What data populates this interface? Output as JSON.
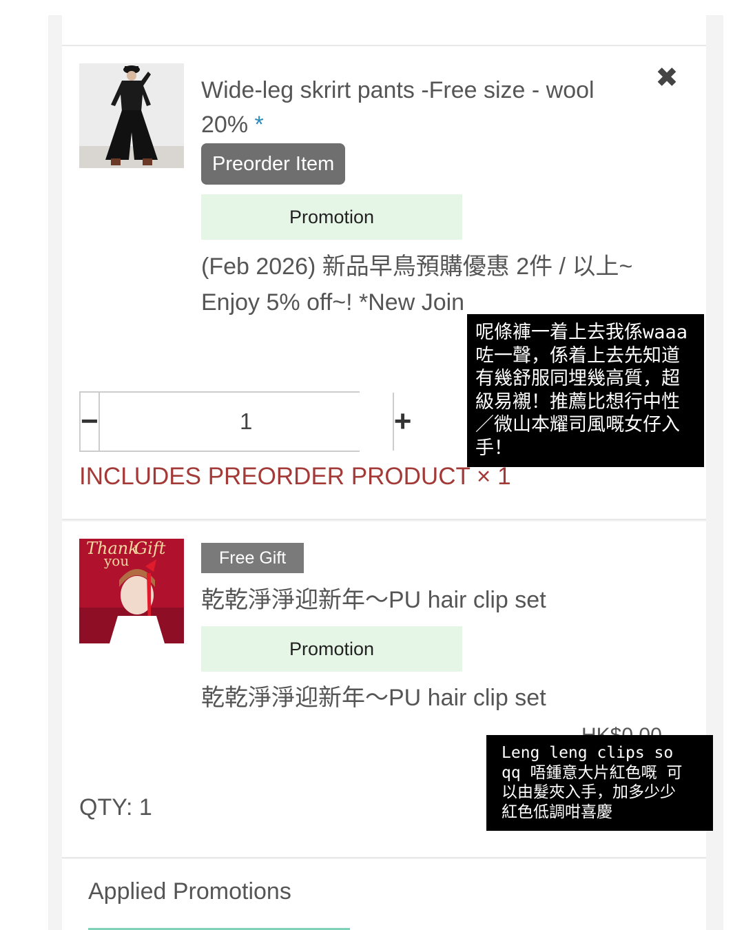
{
  "items": [
    {
      "title": "Wide-leg skrirt pants -Free size - wool 20%",
      "required_mark": "*",
      "badge": "Preorder Item",
      "promotion_label": "Promotion",
      "promotion_desc": "(Feb 2026) 新品早鳥預購優惠 2件 / 以上~ Enjoy 5% off~! *New Join",
      "quantity": "1",
      "minus_label": "−",
      "plus_label": "+",
      "preorder_note": "INCLUDES PREORDER PRODUCT × 1",
      "thumbnail": "black outfit model photo"
    },
    {
      "badge": "Free Gift",
      "title": "乾乾淨淨迎新年～PU hair clip set",
      "promotion_label": "Promotion",
      "promotion_desc": "乾乾淨淨迎新年～PU hair clip set",
      "price": "HK$0.00",
      "qty_text": "QTY: 1",
      "thumbnail_text": [
        "Thank",
        "you",
        "Gift"
      ]
    }
  ],
  "applied_promotions": {
    "title": "Applied Promotions"
  },
  "overlays": [
    {
      "lines": [
        "呢條褲一着上去我係waaa",
        "咗一聲，係着上去先知道",
        "有幾舒服同埋幾高質，超",
        "級易襯！推薦比想行中性",
        "／微山本耀司風嘅女仔入",
        "手！"
      ]
    },
    {
      "lines": [
        "Leng leng clips so",
        "qq 唔鍾意大片紅色嘅 可",
        "以由髮夾入手，加多少少",
        "紅色低調咁喜慶"
      ]
    }
  ],
  "colors": {
    "page_bg": "#f3f3f3",
    "promo_bg": "#e6f6e6",
    "preorder_note": "#a23a38",
    "asterisk": "#2a8ab8",
    "preorder_badge": "#6f6f6f",
    "gift_badge": "#7a7a7a"
  },
  "icons": {
    "remove": "close-x-icon",
    "minus": "minus-icon",
    "plus": "plus-icon"
  }
}
